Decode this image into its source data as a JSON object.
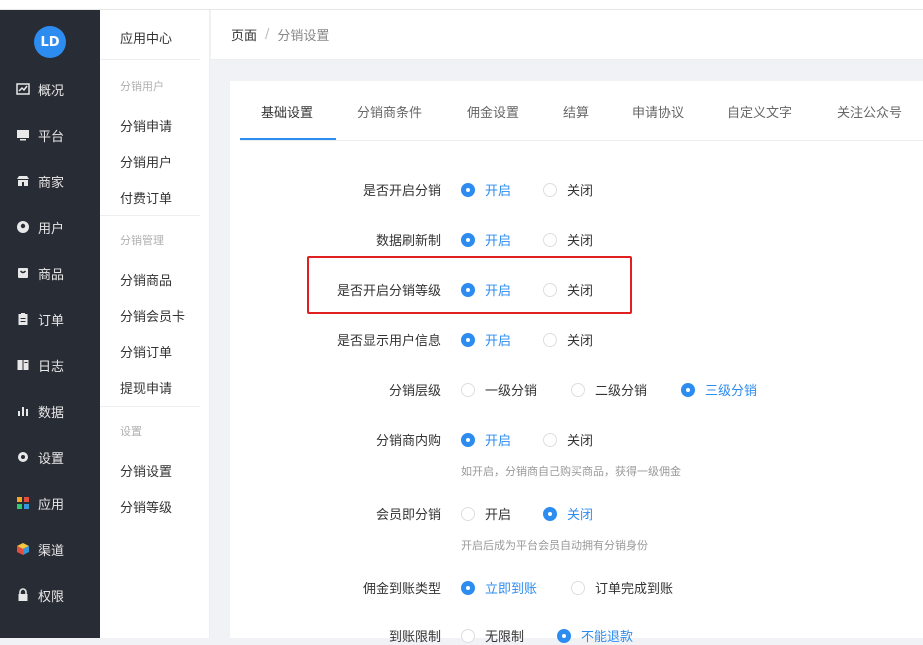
{
  "nav": {
    "items": [
      {
        "icon": "chart-line-icon",
        "label": "概况"
      },
      {
        "icon": "monitor-icon",
        "label": "平台"
      },
      {
        "icon": "store-icon",
        "label": "商家"
      },
      {
        "icon": "user-icon",
        "label": "用户"
      },
      {
        "icon": "shopping-bag-icon",
        "label": "商品"
      },
      {
        "icon": "clipboard-icon",
        "label": "订单"
      },
      {
        "icon": "book-icon",
        "label": "日志"
      },
      {
        "icon": "bar-chart-icon",
        "label": "数据"
      },
      {
        "icon": "gear-icon",
        "label": "设置"
      },
      {
        "icon": "apps-grid-icon",
        "label": "应用"
      },
      {
        "icon": "cube-icon",
        "label": "渠道"
      },
      {
        "icon": "lock-icon",
        "label": "权限"
      }
    ]
  },
  "sub": {
    "title": "应用中心",
    "groups": [
      {
        "label": "分销用户",
        "links": [
          "分销申请",
          "分销用户",
          "付费订单"
        ]
      },
      {
        "label": "分销管理",
        "links": [
          "分销商品",
          "分销会员卡",
          "分销订单",
          "提现申请"
        ]
      },
      {
        "label": "设置",
        "links": [
          "分销设置",
          "分销等级"
        ]
      }
    ]
  },
  "breadcrumb": {
    "root": "页面",
    "separator": "/",
    "current": "分销设置"
  },
  "tabs": [
    "基础设置",
    "分销商条件",
    "佣金设置",
    "结算",
    "申请协议",
    "自定义文字",
    "关注公众号"
  ],
  "form": {
    "rows": [
      {
        "label": "是否开启分销",
        "options": [
          "开启",
          "关闭"
        ],
        "selected": 0
      },
      {
        "label": "数据刷新制",
        "options": [
          "开启",
          "关闭"
        ],
        "selected": 0
      },
      {
        "label": "是否开启分销等级",
        "options": [
          "开启",
          "关闭"
        ],
        "selected": 0
      },
      {
        "label": "是否显示用户信息",
        "options": [
          "开启",
          "关闭"
        ],
        "selected": 0
      },
      {
        "label": "分销层级",
        "options": [
          "一级分销",
          "二级分销",
          "三级分销"
        ],
        "selected": 2
      },
      {
        "label": "分销商内购",
        "options": [
          "开启",
          "关闭"
        ],
        "selected": 0,
        "hint": "如开启，分销商自己购买商品，获得一级佣金"
      },
      {
        "label": "会员即分销",
        "options": [
          "开启",
          "关闭"
        ],
        "selected": 1,
        "hint": "开启后成为平台会员自动拥有分销身份"
      },
      {
        "label": "佣金到账类型",
        "options": [
          "立即到账",
          "订单完成到账"
        ],
        "selected": 0
      },
      {
        "label": "到账限制",
        "options": [
          "无限制",
          "不能退款"
        ],
        "selected": 1
      }
    ]
  },
  "colors": {
    "accent": "#2d8cf0",
    "sidebar": "#282c34",
    "highlight": "#e02020"
  }
}
